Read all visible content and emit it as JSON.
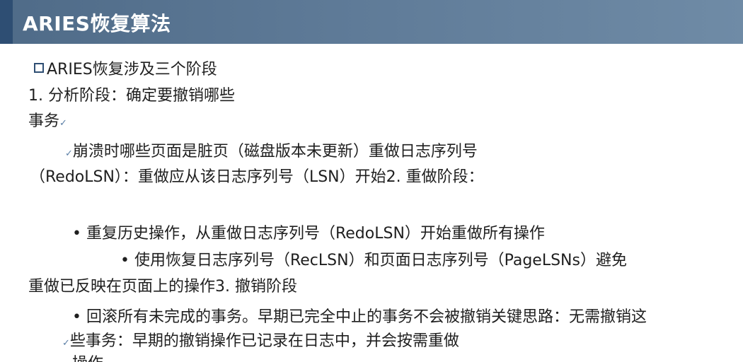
{
  "header": {
    "title": "ARIES恢复算法"
  },
  "lines": [
    "ARIES恢复涉及三个阶段",
    "1. 分析阶段：确定要撤销哪些",
    "事务",
    "崩溃时哪些页面是脏页（磁盘版本未更新）重做日志序列号",
    "（RedoLSN）：重做应从该日志序列号（LSN）开始2. 重做阶段：",
    "• 重复历史操作，从重做日志序列号（RedoLSN）开始重做所有操作",
    "• 使用恢复日志序列号（RecLSN）和页面日志序列号（PageLSNs）避免",
    "重做已反映在页面上的操作3. 撤销阶段",
    "• 回滚所有未完成的事务。早期已完全中止的事务不会被撤销关键思路：无需撤销这",
    "些事务：早期的撤销操作已记录在日志中，并会按需重做",
    "操作"
  ],
  "icons": {
    "square_bullet": "square-bullet-icon",
    "check": "check-icon",
    "check_glyph": "✓"
  },
  "colors": {
    "header_bg": "#5e7a97",
    "header_accent": "#2e4e73",
    "header_text": "#ffffff",
    "body_text": "#1f1f1f"
  }
}
